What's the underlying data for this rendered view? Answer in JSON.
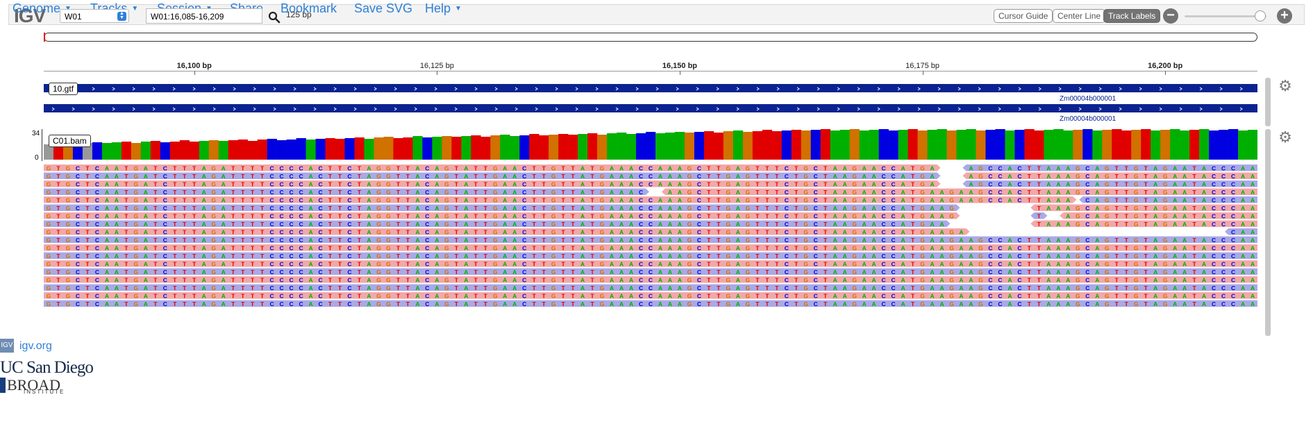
{
  "navbar": {
    "logo": "IGV",
    "menus": [
      {
        "label": "Genome"
      },
      {
        "label": "Tracks"
      },
      {
        "label": "Session"
      },
      {
        "label": "Share"
      },
      {
        "label": "Bookmark"
      },
      {
        "label": "Save SVG"
      },
      {
        "label": "Help"
      }
    ],
    "chromosome": "W01",
    "locus": "W01:16,085-16,209",
    "window_size": "125 bp",
    "buttons": {
      "cursor_guide": "Cursor Guide",
      "center_line": "Center Line",
      "track_labels": "Track Labels"
    },
    "zoom_out": "−",
    "zoom_in": "+",
    "zoom_level": 0.92
  },
  "ruler": {
    "ticks": [
      {
        "label": "16,100 bp",
        "bold": true
      },
      {
        "label": "16,125 bp",
        "bold": false
      },
      {
        "label": "16,150 bp",
        "bold": true
      },
      {
        "label": "16,175 bp",
        "bold": false
      },
      {
        "label": "16,200 bp",
        "bold": true
      }
    ]
  },
  "annotation_track": {
    "name": "10.gtf",
    "features": [
      "Zm00004b000001",
      "Zm00004b000001"
    ]
  },
  "alignment_track": {
    "name": "C01.bam",
    "coverage_range": [
      "34",
      "0"
    ],
    "sequence": "GTGCTCAATGATCTTTAGATTTTCCCCACTTCTAGGTTACAGTATTGAACTTGTTATGAAACCAAAGCTTGAGTTTCTGCTAAGAACCATGAAGAAGCCACTTAAAGCAGTTGTAGAATACCCAA"
  },
  "footer": {
    "link": "igv.org",
    "ucsd": "UC San Diego",
    "broad": "BROAD",
    "institute": "INSTITUTE"
  },
  "colors": {
    "A": "#00b000",
    "C": "#0000e0",
    "G": "#d17100",
    "T": "#e00000",
    "gene": "#0b2391",
    "read_fwd": "#f2a8a8",
    "read_rev": "#a9a9e6",
    "link": "#2f7fd8"
  }
}
